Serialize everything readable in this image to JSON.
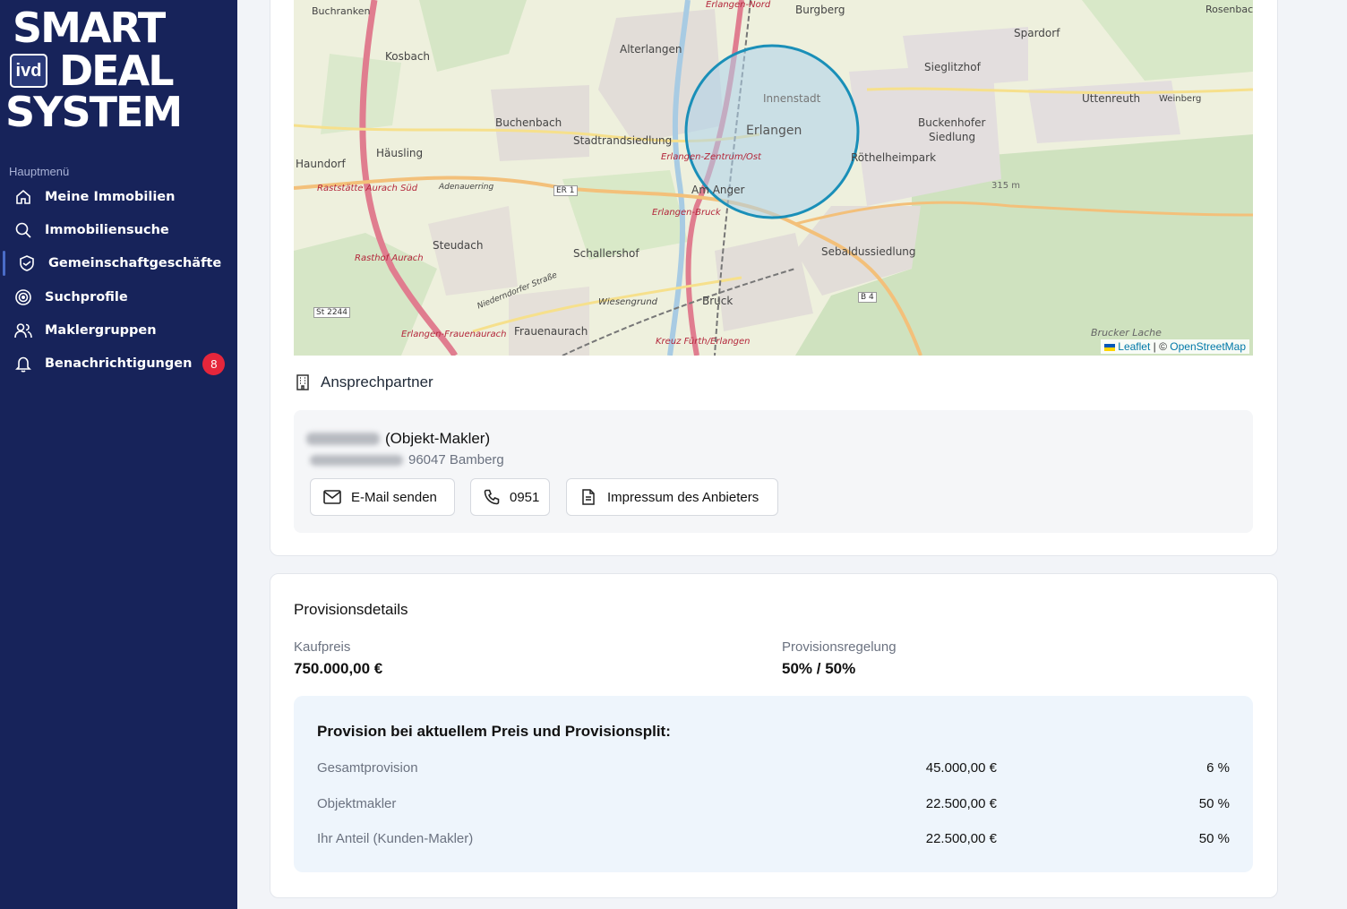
{
  "sidebar": {
    "logo": {
      "line1": "SMART",
      "line2": "DEAL",
      "line3": "SYSTEM",
      "badge": "ivd"
    },
    "menu_title": "Hauptmenü",
    "items": [
      {
        "label": "Meine Immobilien",
        "icon": "home-icon"
      },
      {
        "label": "Immobiliensuche",
        "icon": "search-icon"
      },
      {
        "label": "Gemeinschaftgeschäfte",
        "icon": "handshake-shield-icon",
        "active": true
      },
      {
        "label": "Suchprofile",
        "icon": "target-icon"
      },
      {
        "label": "Maklergruppen",
        "icon": "users-icon"
      },
      {
        "label": "Benachrichtigungen",
        "icon": "bell-icon",
        "badge": "8"
      }
    ],
    "colors": {
      "background": "#17235a",
      "badge": "#e5263b"
    }
  },
  "map": {
    "places": {
      "buchenbach": "Buchenbach",
      "kosbach": "Kosbach",
      "alterlangen": "Alterlangen",
      "burgberg": "Burgberg",
      "spardorf": "Spardorf",
      "sieglitzhof": "Sieglitzhof",
      "uttenreuth": "Uttenreuth",
      "weinberg": "Weinberg",
      "innenstadt": "Innenstadt",
      "erlangen": "Erlangen",
      "buckenhofer": "Buckenhofer",
      "siedlung": "Siedlung",
      "haundorf": "Haundorf",
      "haeusling": "Häusling",
      "stadtrandsiedlung": "Stadtrandsiedlung",
      "rothelheimpark": "Röthelheimpark",
      "am_anger": "Am Anger",
      "steudach": "Steudach",
      "schallershof": "Schallershof",
      "sebaldussiedlung": "Sebaldussiedlung",
      "bruck": "Bruck",
      "frauenaurach": "Frauenaurach",
      "wiesengrund": "Wiesengrund",
      "buchenrain": "Buchranken",
      "rosenbach": "Rosenbach",
      "brucker_lache": "Brucker Lache",
      "elevation": "315 m",
      "adenauerring": "Adenauerring",
      "niederndorfer": "Niederndorfer Straße",
      "erlangen_nord": "Erlangen-Nord",
      "erlangen_zentrum": "Erlangen-Zentrum/Ost",
      "erlangen_bruck": "Erlangen-Bruck",
      "erlangen_frauenaurach": "Erlangen-Frauenaurach",
      "kreuz_fuerth": "Kreuz Fürth/Erlangen",
      "rastst_aurach": "Raststätte Aurach Süd",
      "rasthof_aurach": "Rasthof Aurach",
      "road_er1": "ER 1",
      "road_b4": "B 4",
      "road_st2244": "St 2244"
    },
    "attribution": {
      "leaflet": "Leaflet",
      "separator": "| ©",
      "osm": "OpenStreetMap"
    },
    "circle_color": "#1a8fb8"
  },
  "contact": {
    "section_title": "Ansprechpartner",
    "role": "(Objekt-Makler)",
    "city": "96047 Bamberg",
    "buttons": {
      "email": "E-Mail senden",
      "phone": "0951",
      "impressum": "Impressum des Anbieters"
    }
  },
  "provision": {
    "title": "Provisionsdetails",
    "kaufpreis_label": "Kaufpreis",
    "kaufpreis_value": "750.000,00 €",
    "regelung_label": "Provisionsregelung",
    "regelung_value": "50% / 50%",
    "box_title": "Provision bei aktuellem Preis und Provisionsplit:",
    "rows": [
      {
        "label": "Gesamtprovision",
        "amount": "45.000,00 €",
        "percent": "6 %"
      },
      {
        "label": "Objektmakler",
        "amount": "22.500,00 €",
        "percent": "50 %"
      },
      {
        "label": "Ihr Anteil (Kunden-Makler)",
        "amount": "22.500,00 €",
        "percent": "50 %"
      }
    ]
  }
}
